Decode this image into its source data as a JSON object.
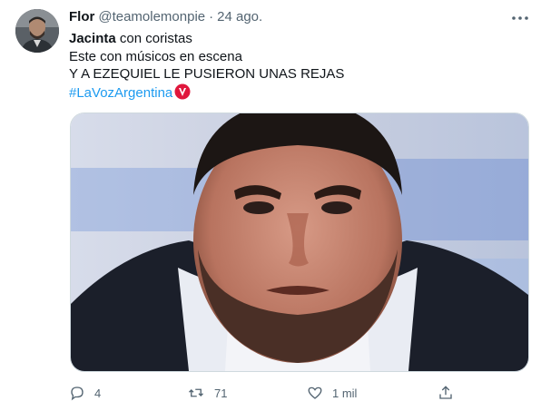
{
  "author": {
    "name": "Flor",
    "handle": "@teamolemonpie",
    "separator": "·",
    "date": "24 ago."
  },
  "tweet": {
    "line1_bold": "Jacinta",
    "line1_rest": " con coristas",
    "line2": "Este con músicos en escena",
    "line3": "Y A EZEQUIEL LE PUSIERON UNAS REJAS",
    "hashtag": "#LaVozArgentina"
  },
  "actions": {
    "replies": "4",
    "retweets": "71",
    "likes": "1 mil"
  },
  "icons": {
    "more": "more-dots-icon",
    "reply": "reply-icon",
    "retweet": "retweet-icon",
    "like": "heart-icon",
    "share": "share-icon",
    "hashflag": "la-voz-hashflag-icon"
  },
  "colors": {
    "link": "#1d9bf0",
    "secondary_text": "#536471",
    "hashflag_red": "#e0173c"
  }
}
